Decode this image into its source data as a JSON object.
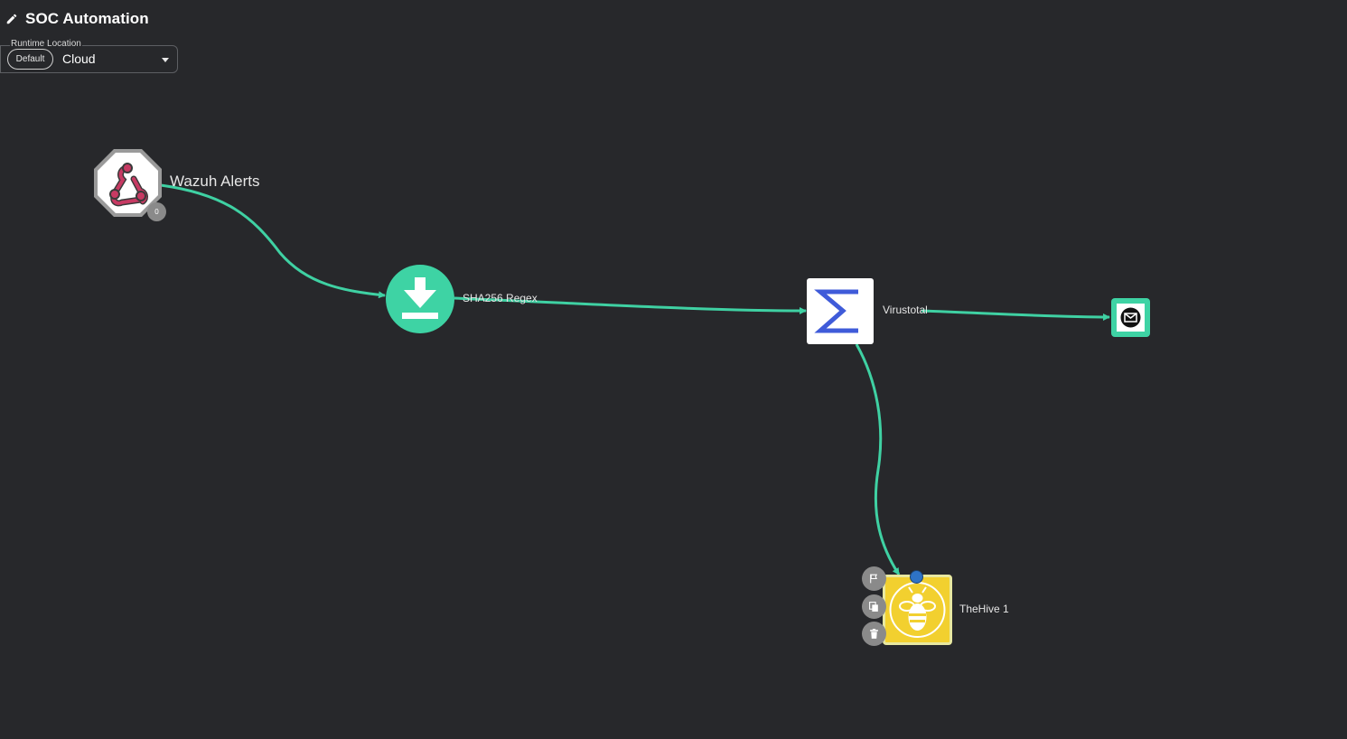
{
  "workflow": {
    "title": "SOC Automation"
  },
  "runtime": {
    "label": "Runtime Location",
    "chip": "Default",
    "value": "Cloud"
  },
  "nodes": {
    "webhook": {
      "label": "Wazuh Alerts",
      "badge": "0",
      "icon": "webhook-icon"
    },
    "regex": {
      "label": "SHA256 Regex",
      "icon": "download-icon"
    },
    "virustotal": {
      "label": "Virustotal",
      "icon": "sigma-icon"
    },
    "email": {
      "label": "",
      "icon": "email-icon"
    },
    "thehive": {
      "label": "TheHive 1",
      "icon": "bee-icon"
    }
  },
  "node_actions": [
    "flag-icon",
    "copy-icon",
    "trash-icon"
  ],
  "colors": {
    "background": "#27282b",
    "edge": "#3fd1a3",
    "accent_green": "#3ed3a4",
    "virustotal_blue": "#3f5bd9",
    "thehive_yellow": "#f2d02f",
    "selected_dot": "#2e73c7"
  }
}
